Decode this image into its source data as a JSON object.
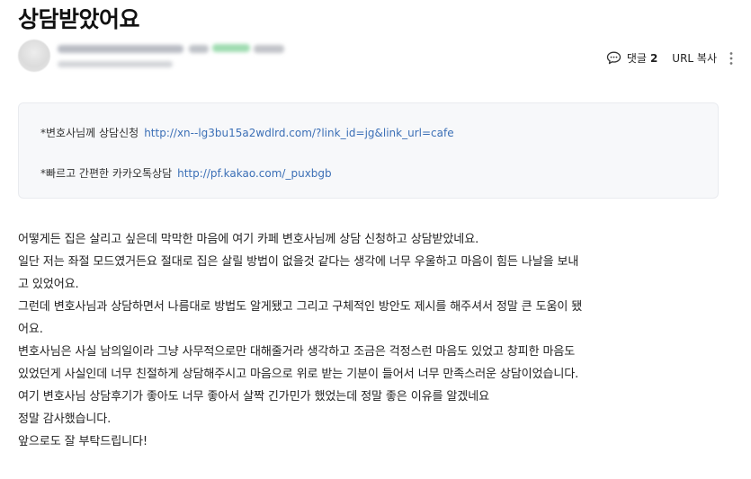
{
  "post": {
    "title": "상담받았어요"
  },
  "actions": {
    "reply_label": "댓글",
    "reply_count": "2",
    "url_copy": "URL 복사"
  },
  "info_box": {
    "line1_label": "*변호사님께 상담신청",
    "line1_link": "http://xn--lg3bu15a2wdlrd.com/?link_id=jg&link_url=cafe",
    "line2_label": "*빠르고 간편한 카카오톡상담",
    "line2_link": "http://pf.kakao.com/_puxbgb"
  },
  "body": {
    "lines": [
      "어떻게든 집은 살리고 싶은데 막막한 마음에 여기 카페 변호사님께 상담 신청하고 상담받았네요.",
      "일단 저는 좌절 모드였거든요 절대로 집은 살릴 방법이 없을것 같다는 생각에 너무 우울하고 마음이 힘든 나날을 보내",
      "고 있었어요.",
      "그런데 변호사님과 상담하면서 나름대로 방법도 알게됐고 그리고 구체적인 방안도 제시를 해주셔서 정말 큰 도움이 됐",
      "어요.",
      "변호사님은 사실 남의일이라 그냥 사무적으로만 대해줄거라 생각하고 조금은 걱정스런 마음도 있었고 창피한 마음도",
      "있었던게 사실인데 너무 친절하게 상담해주시고 마음으로 위로 받는 기분이 들어서 너무 만족스러운 상담이었습니다.",
      "여기 변호사님 상담후기가 좋아도 너무 좋아서 살짝 긴가민가 했었는데 정말 좋은 이유를 알겠네요",
      "정말 감사했습니다.",
      "앞으로도 잘 부탁드립니다!"
    ]
  }
}
